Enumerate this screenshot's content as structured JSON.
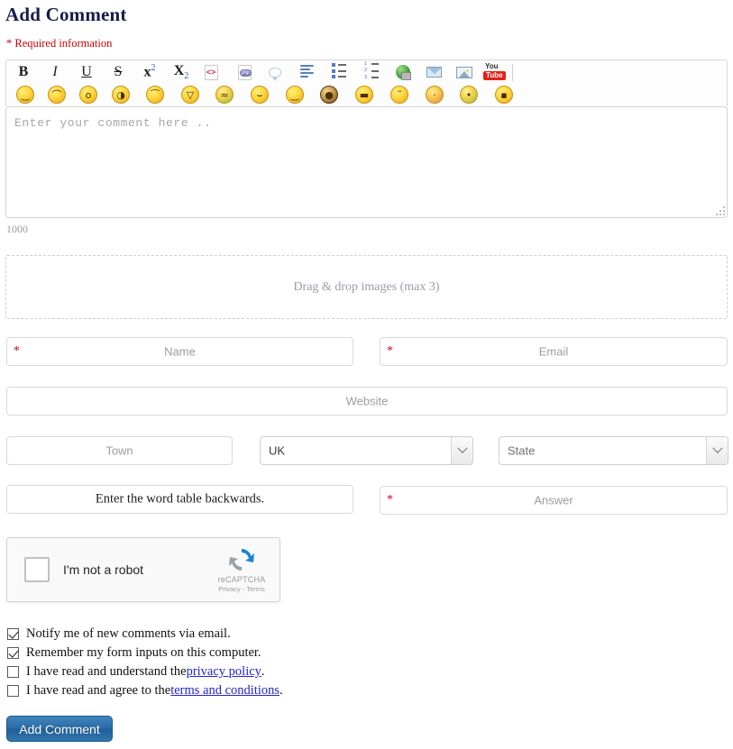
{
  "header": {
    "title": "Add Comment",
    "required_note": "* Required information"
  },
  "editor": {
    "toolbar_buttons": [
      {
        "name": "bold-button",
        "label": "B",
        "type": "text"
      },
      {
        "name": "italic-button",
        "label": "I",
        "type": "text"
      },
      {
        "name": "underline-button",
        "label": "U",
        "type": "text"
      },
      {
        "name": "strikethrough-button",
        "label": "S",
        "type": "text"
      },
      {
        "name": "superscript-button",
        "label": "x2",
        "type": "text"
      },
      {
        "name": "subscript-button",
        "label": "x2",
        "type": "text"
      },
      {
        "name": "code-button",
        "label": "<>",
        "type": "icon"
      },
      {
        "name": "php-button",
        "label": "php",
        "type": "icon"
      },
      {
        "name": "quote-button",
        "label": "quote",
        "type": "icon"
      },
      {
        "name": "align-button",
        "label": "align",
        "type": "icon"
      },
      {
        "name": "unordered-list-button",
        "label": "bullet list",
        "type": "icon"
      },
      {
        "name": "ordered-list-button",
        "label": "numbered list",
        "type": "icon"
      },
      {
        "name": "link-button",
        "label": "link",
        "type": "icon"
      },
      {
        "name": "email-button",
        "label": "email",
        "type": "icon"
      },
      {
        "name": "image-button",
        "label": "image",
        "type": "icon"
      },
      {
        "name": "youtube-button",
        "label": "YouTube",
        "type": "icon"
      }
    ],
    "youtube_top": "You",
    "youtube_bottom": "Tube",
    "code_glyph": "<>",
    "php_glyph": "php",
    "emoticons": [
      {
        "name": "emoticon-smile",
        "glyph": "‿"
      },
      {
        "name": "emoticon-sad",
        "glyph": "⌒"
      },
      {
        "name": "emoticon-surprised",
        "glyph": "o"
      },
      {
        "name": "emoticon-laugh",
        "glyph": "◑"
      },
      {
        "name": "emoticon-angry",
        "glyph": "⁀"
      },
      {
        "name": "emoticon-tongue",
        "glyph": "▽"
      },
      {
        "name": "emoticon-sick",
        "glyph": "≈"
      },
      {
        "name": "emoticon-grin",
        "glyph": "⌣"
      },
      {
        "name": "emoticon-wink",
        "glyph": "‿"
      },
      {
        "name": "emoticon-shocked",
        "glyph": "●"
      },
      {
        "name": "emoticon-cool",
        "glyph": "▬"
      },
      {
        "name": "emoticon-relieved",
        "glyph": "˜"
      },
      {
        "name": "emoticon-blush",
        "glyph": "·"
      },
      {
        "name": "emoticon-confused",
        "glyph": "•"
      },
      {
        "name": "emoticon-kiss",
        "glyph": "▪"
      }
    ],
    "comment_placeholder": "Enter your comment here ..",
    "char_counter": "1000"
  },
  "dropzone": {
    "label": "Drag & drop images (max 3)"
  },
  "fields": {
    "name": {
      "placeholder": "Name",
      "required_mark": "*",
      "value": ""
    },
    "email": {
      "placeholder": "Email",
      "required_mark": "*",
      "value": ""
    },
    "website": {
      "placeholder": "Website",
      "value": ""
    },
    "town": {
      "placeholder": "Town",
      "value": ""
    },
    "country": {
      "selected": "UK"
    },
    "state": {
      "selected": "State"
    },
    "question": {
      "text": "Enter the word table backwards."
    },
    "answer": {
      "placeholder": "Answer",
      "required_mark": "*",
      "value": ""
    }
  },
  "recaptcha": {
    "label": "I'm not a robot",
    "brand": "reCAPTCHA",
    "terms": "Privacy - Terms"
  },
  "checkboxes": [
    {
      "name": "notify-new-comments-checkbox",
      "text": "Notify me of new comments via email.",
      "checked": true
    },
    {
      "name": "remember-inputs-checkbox",
      "text": "Remember my form inputs on this computer.",
      "checked": true
    },
    {
      "name": "privacy-policy-checkbox",
      "text_before": "I have read and understand the ",
      "link": "privacy policy",
      "text_after": ".",
      "checked": false
    },
    {
      "name": "terms-conditions-checkbox",
      "text_before": "I have read and agree to the ",
      "link": "terms and conditions",
      "text_after": ".",
      "checked": false
    }
  ],
  "submit": {
    "label": "Add Comment"
  },
  "colors": {
    "title": "#1a1a4e",
    "required": "#cc0000",
    "link": "#2424cf",
    "button": "#2a6ca5",
    "placeholder": "#9c9c9c"
  }
}
